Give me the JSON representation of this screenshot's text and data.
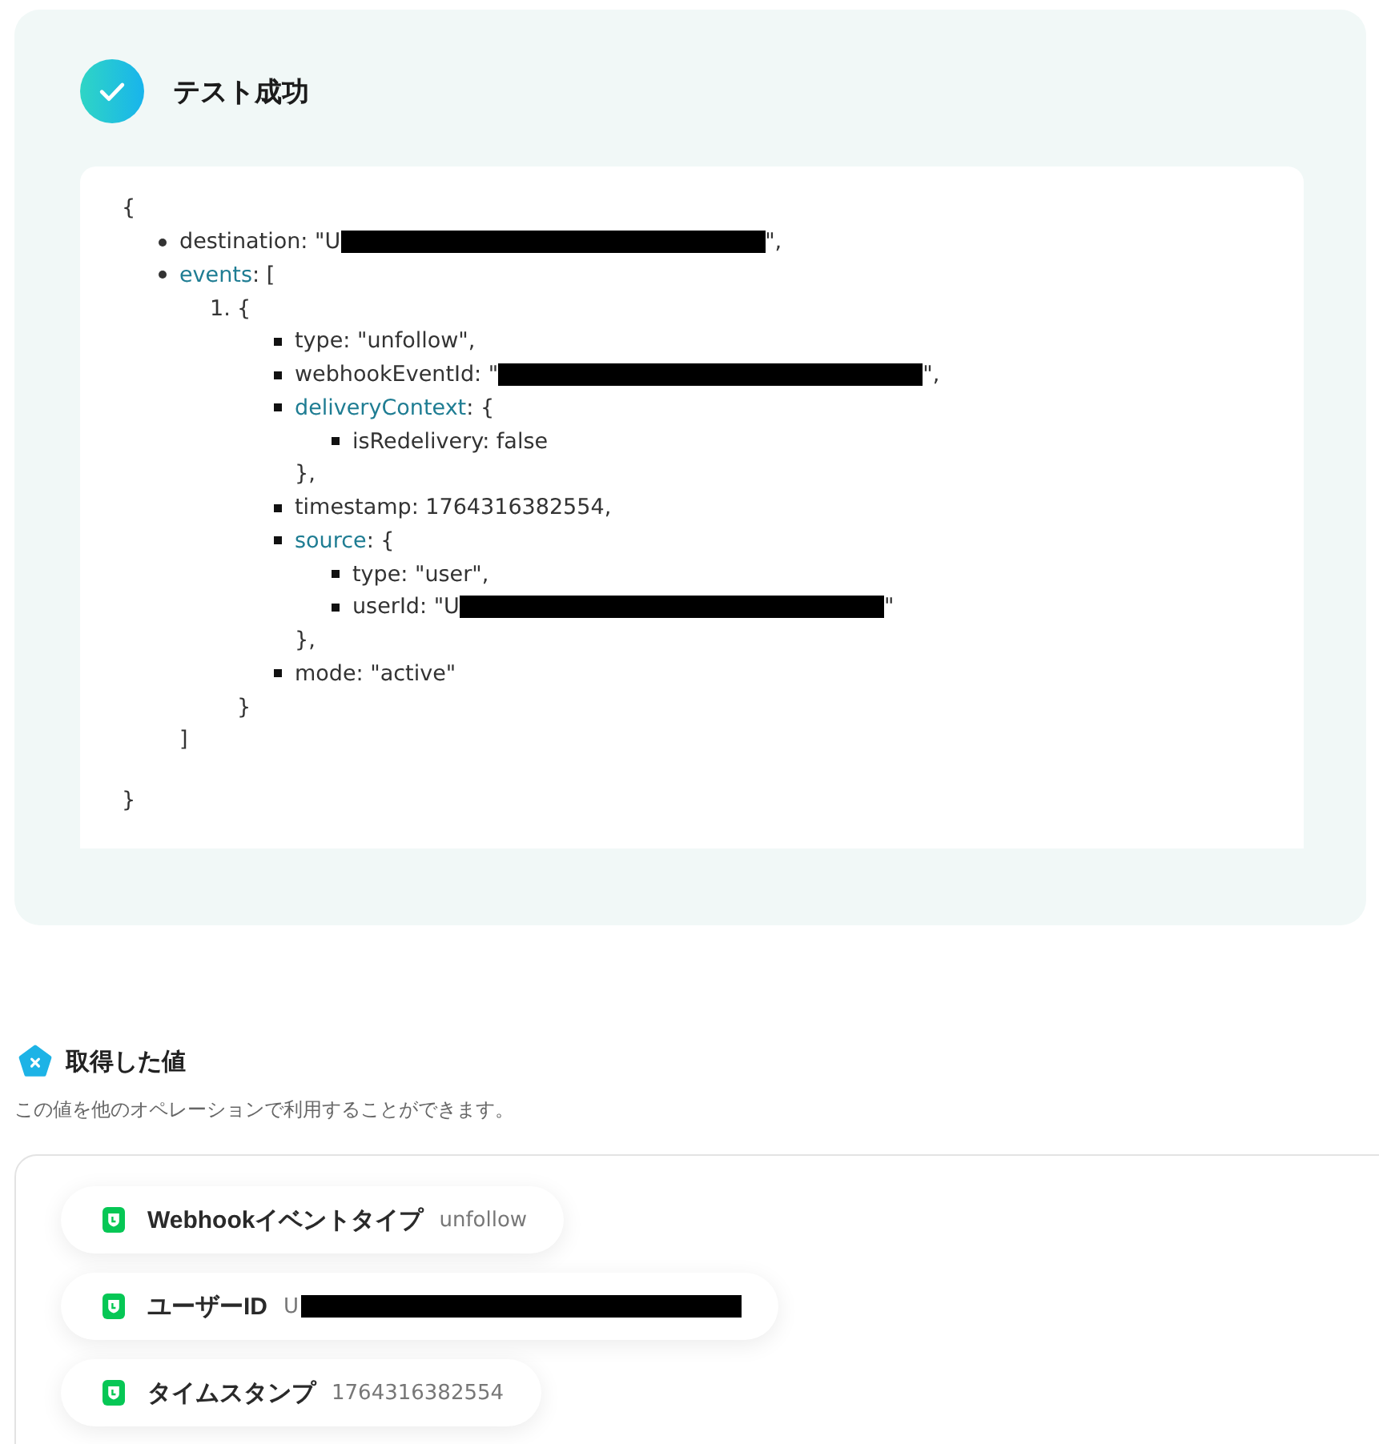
{
  "result": {
    "title": "テスト成功",
    "code": {
      "open": "{",
      "close": "}",
      "items": [
        {
          "kind": "value",
          "key": "destination",
          "rest": ": \"U",
          "redacted": true,
          "tail": "\","
        },
        {
          "kind": "array",
          "key": "events",
          "rest": ": [",
          "close": "]",
          "children": [
            {
              "kind": "entry",
              "number": "1.",
              "text": "{",
              "close": "}",
              "children": [
                {
                  "kind": "value",
                  "key": "type",
                  "rest": ": \"unfollow\","
                },
                {
                  "kind": "value",
                  "key": "webhookEventId",
                  "rest": ": \"",
                  "redacted": true,
                  "tail": "\","
                },
                {
                  "kind": "object",
                  "key": "deliveryContext",
                  "rest": ": {",
                  "close": "},",
                  "children": [
                    {
                      "kind": "value",
                      "key": "isRedelivery",
                      "rest": ": false"
                    }
                  ]
                },
                {
                  "kind": "value",
                  "key": "timestamp",
                  "rest": ": 1764316382554,"
                },
                {
                  "kind": "object",
                  "key": "source",
                  "rest": ": {",
                  "close": "},",
                  "children": [
                    {
                      "kind": "value",
                      "key": "type",
                      "rest": ": \"user\","
                    },
                    {
                      "kind": "value",
                      "key": "userId",
                      "rest": ": \"U",
                      "redacted": true,
                      "tail": "\""
                    }
                  ]
                },
                {
                  "kind": "value",
                  "key": "mode",
                  "rest": ": \"active\""
                }
              ]
            }
          ]
        }
      ]
    }
  },
  "outputs": {
    "title": "取得した値",
    "description": "この値を他のオペレーションで利用することができます。",
    "items": [
      {
        "label": "Webhookイベントタイプ",
        "value": "unfollow",
        "redacted": false
      },
      {
        "label": "ユーザーID",
        "value": "U",
        "redacted": true
      },
      {
        "label": "タイムスタンプ",
        "value": "1764316382554",
        "redacted": false
      }
    ]
  }
}
